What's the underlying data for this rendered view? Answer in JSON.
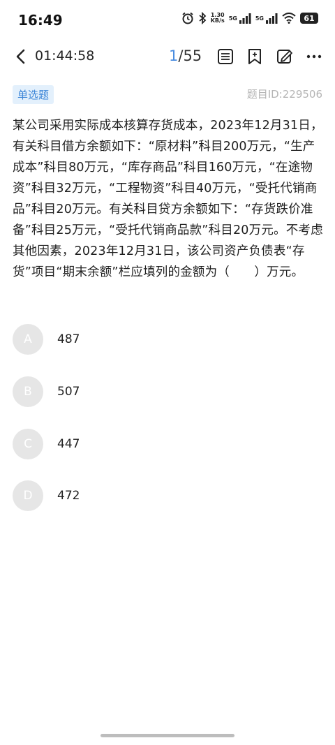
{
  "status_bar": {
    "time": "16:49",
    "net_speed_value": "1.30",
    "net_speed_unit": "KB/s",
    "signal1_label": "5G",
    "signal2_label": "5G",
    "battery": "61"
  },
  "header": {
    "timer": "01:44:58",
    "current": "1",
    "total": "/55"
  },
  "question": {
    "type_tag": "单选题",
    "id_label": "题目ID:229506",
    "text": "某公司采用实际成本核算存货成本，2023年12月31日，有关科目借方余额如下：“原材料”科目200万元，“生产成本”科目80万元，“库存商品”科目160万元，“在途物资”科目32万元，“工程物资”科目40万元，“受托代销商品”科目20万元。有关科目贷方余额如下：“存货跌价准备”科目25万元，“受托代销商品款”科目20万元。不考虑其他因素，2023年12月31日，该公司资产负债表“存货”项目“期末余额”栏应填列的金额为（　　）万元。"
  },
  "options": [
    {
      "letter": "A",
      "text": "487"
    },
    {
      "letter": "B",
      "text": "507"
    },
    {
      "letter": "C",
      "text": "447"
    },
    {
      "letter": "D",
      "text": "472"
    }
  ]
}
